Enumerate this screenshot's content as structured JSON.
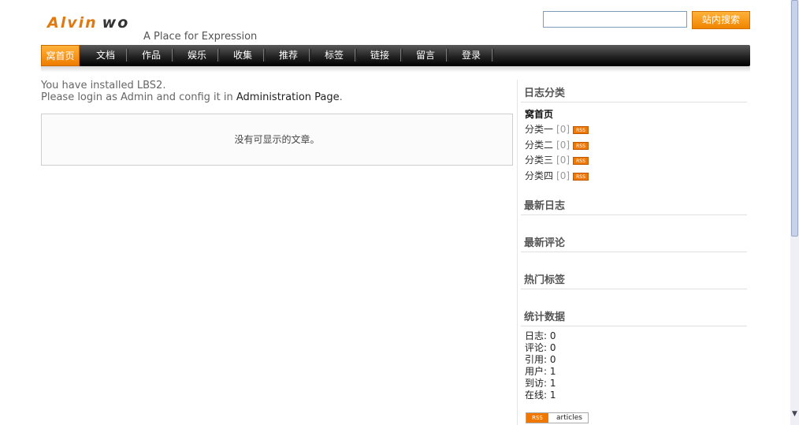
{
  "header": {
    "logo_first": "Alvin",
    "logo_second": "wo",
    "tagline": "A Place for Expression",
    "search_placeholder": "",
    "search_button": "站内搜索"
  },
  "nav": [
    {
      "label": "窝首页",
      "active": true
    },
    {
      "label": "文档",
      "active": false
    },
    {
      "label": "作品",
      "active": false
    },
    {
      "label": "娱乐",
      "active": false
    },
    {
      "label": "收集",
      "active": false
    },
    {
      "label": "推荐",
      "active": false
    },
    {
      "label": "标签",
      "active": false
    },
    {
      "label": "链接",
      "active": false
    },
    {
      "label": "留言",
      "active": false
    },
    {
      "label": "登录",
      "active": false
    }
  ],
  "main": {
    "install_line1": "You have installed LBS2.",
    "install_line2_prefix": "Please login as Admin and config it in ",
    "install_link": "Administration Page",
    "install_line2_suffix": ".",
    "empty_message": "没有可显示的文章。"
  },
  "sidebar": {
    "categories_title": "日志分类",
    "home": "窝首页",
    "categories": [
      {
        "name": "分类一",
        "count": "[0]",
        "rss": "RSS"
      },
      {
        "name": "分类二",
        "count": "[0]",
        "rss": "RSS"
      },
      {
        "name": "分类三",
        "count": "[0]",
        "rss": "RSS"
      },
      {
        "name": "分类四",
        "count": "[0]",
        "rss": "RSS"
      }
    ],
    "latest_logs_title": "最新日志",
    "latest_comments_title": "最新评论",
    "hot_tags_title": "热门标签",
    "stats_title": "统计数据",
    "stats": [
      "日志: 0",
      "评论: 0",
      "引用: 0",
      "用户: 1",
      "到访: 1",
      "在线: 1"
    ],
    "badge_rss": "RSS",
    "badge_text": "articles"
  },
  "colors": {
    "accent": "#f08400",
    "nav_bg": "#1e1e1e"
  }
}
